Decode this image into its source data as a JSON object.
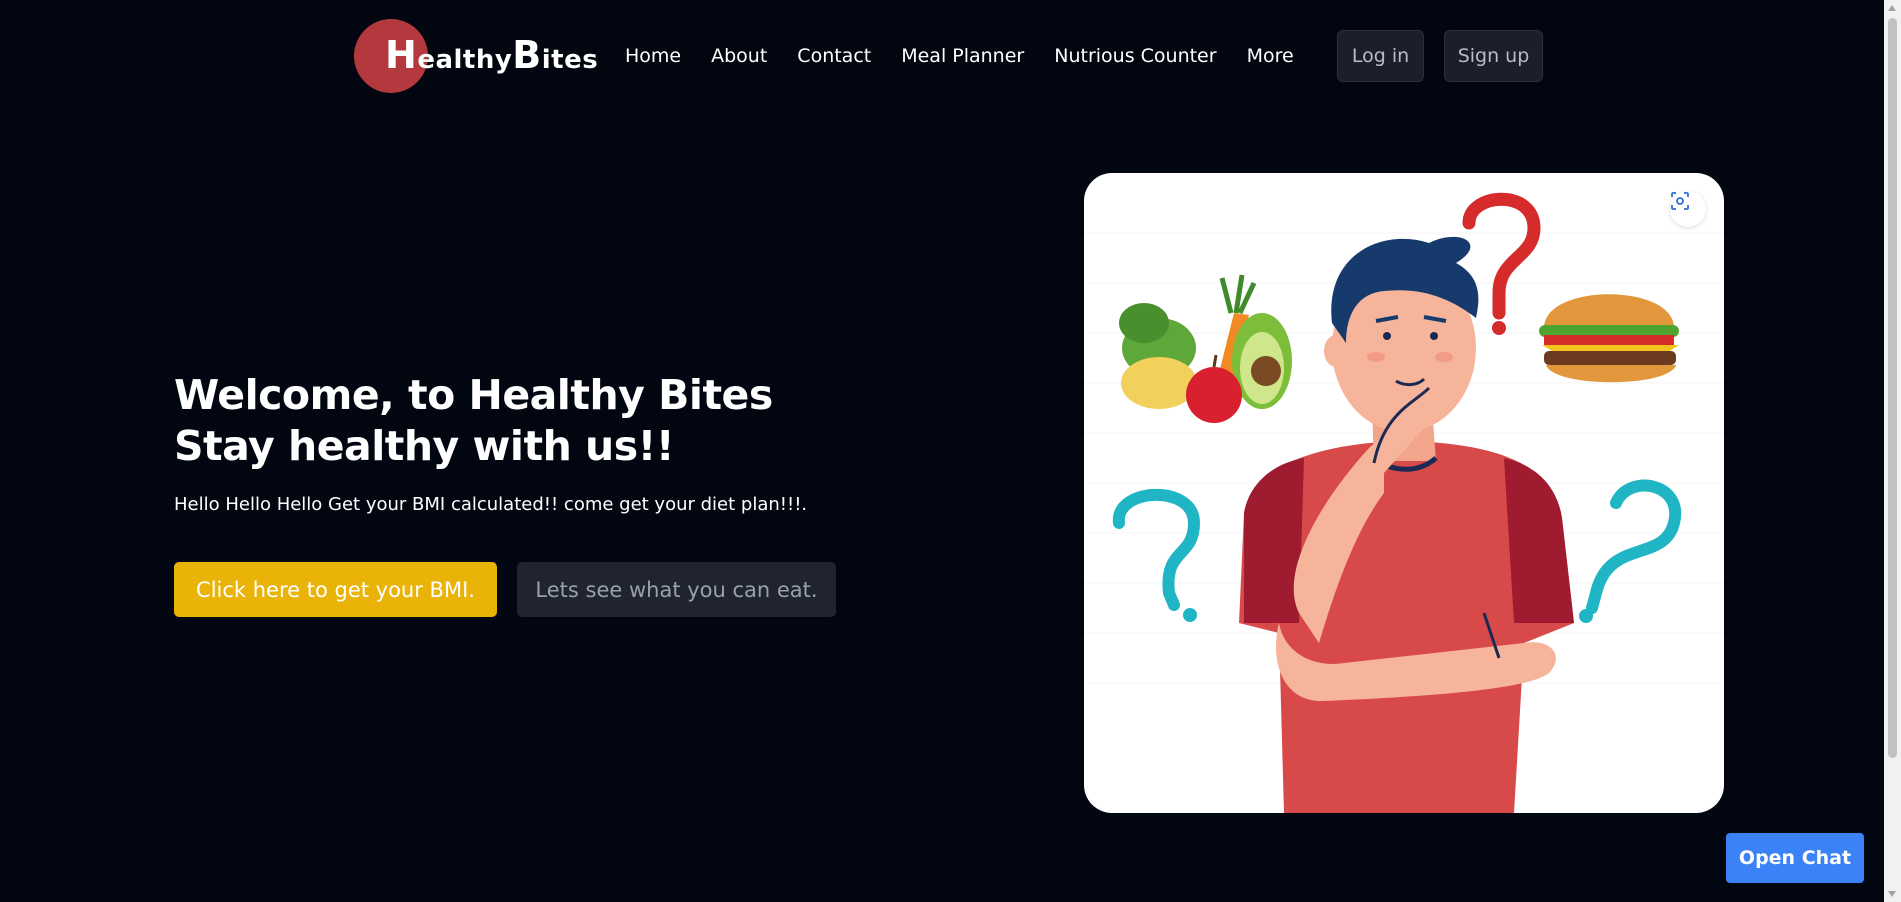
{
  "header": {
    "logo": {
      "first_cap": "H",
      "first_rest": "ealthy",
      "second_cap": "B",
      "second_rest": "ites",
      "circle_color": "#b3393f"
    },
    "nav": [
      {
        "label": "Home"
      },
      {
        "label": "About"
      },
      {
        "label": "Contact"
      },
      {
        "label": "Meal Planner"
      },
      {
        "label": "Nutrious Counter"
      },
      {
        "label": "More"
      }
    ],
    "login_label": "Log in",
    "signup_label": "Sign up"
  },
  "hero": {
    "title_line1": "Welcome, to Healthy Bites",
    "title_line2": "Stay healthy with us!!",
    "subtitle": "Hello Hello Hello Get your BMI calculated!! come get your diet plan!!!.",
    "primary_button": "Click here to get your BMI.",
    "secondary_button": "Lets see what you can eat.",
    "primary_color": "#eab308"
  },
  "illustration": {
    "icons": [
      "scan-icon",
      "thinking-man",
      "salad-icon",
      "burger-icon",
      "question-mark-icon"
    ]
  },
  "chat": {
    "button_label": "Open Chat",
    "color": "#3b82f6"
  }
}
